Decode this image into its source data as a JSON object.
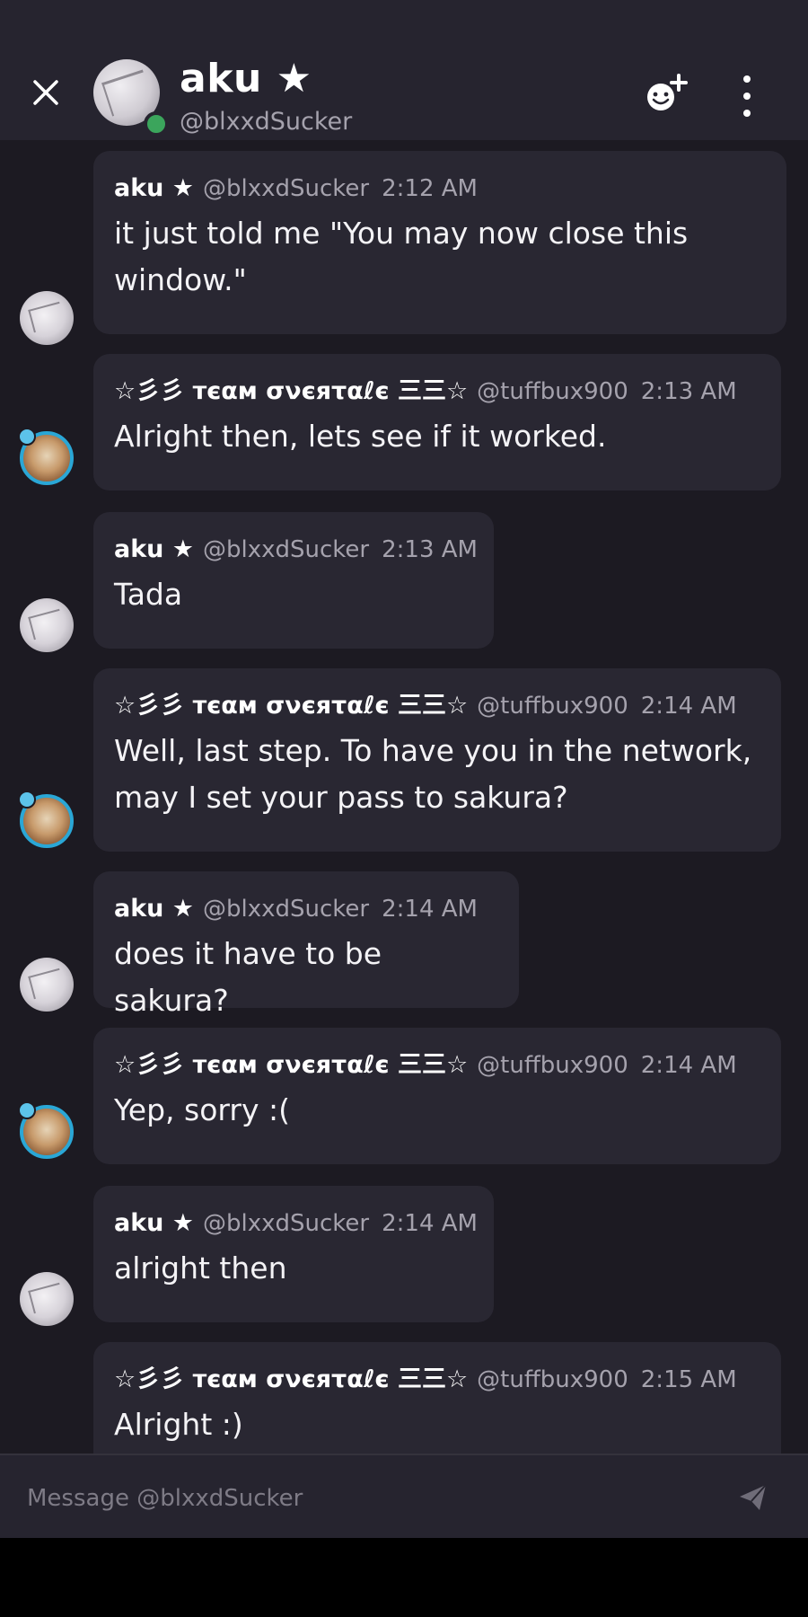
{
  "header": {
    "name": "aku ★",
    "handle": "@blxxdSucker",
    "status": "online"
  },
  "composer": {
    "placeholder": "Message @blxxdSucker"
  },
  "icons": {
    "close": "close-icon",
    "add_friend": "add-friend-icon",
    "more": "more-vertical-icon",
    "send": "send-icon"
  },
  "colors": {
    "background": "#1c1a22",
    "header": "#26242f",
    "bubble": "#292732",
    "online": "#3ba55c"
  },
  "messages": [
    {
      "author": "aku ★",
      "handle": "@blxxdSucker",
      "time": "2:12 AM",
      "text": "it just told me \"You may now close this window.\""
    },
    {
      "author": "☆彡彡 тєαм σνєяταℓє 三三☆",
      "handle": "@tuffbux900",
      "time": "2:13 AM",
      "text": "Alright then, lets see if it worked."
    },
    {
      "author": "aku ★",
      "handle": "@blxxdSucker",
      "time": "2:13 AM",
      "text": "Tada"
    },
    {
      "author": "☆彡彡 тєαм σνєяταℓє 三三☆",
      "handle": "@tuffbux900",
      "time": "2:14 AM",
      "text": "Well, last step. To have you in the network, may I set your pass to sakura?"
    },
    {
      "author": "aku ★",
      "handle": "@blxxdSucker",
      "time": "2:14 AM",
      "text": "does it have to be sakura?"
    },
    {
      "author": "☆彡彡 тєαм σνєяταℓє 三三☆",
      "handle": "@tuffbux900",
      "time": "2:14 AM",
      "text": "Yep, sorry :("
    },
    {
      "author": "aku ★",
      "handle": "@blxxdSucker",
      "time": "2:14 AM",
      "text": "alright then"
    },
    {
      "author": "☆彡彡 тєαм σνєяταℓє 三三☆",
      "handle": "@tuffbux900",
      "time": "2:15 AM",
      "text": "Alright :)"
    }
  ]
}
